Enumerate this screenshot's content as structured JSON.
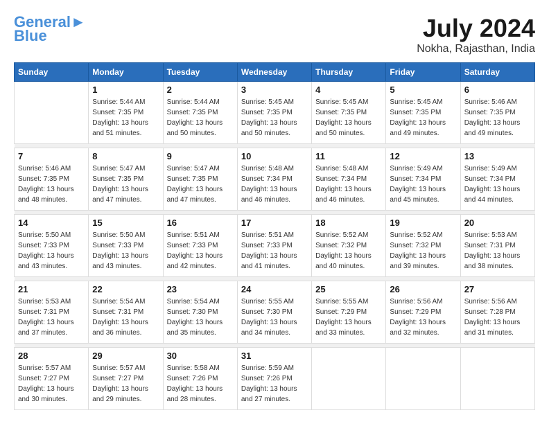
{
  "logo": {
    "line1": "General",
    "line2": "Blue"
  },
  "title": "July 2024",
  "location": "Nokha, Rajasthan, India",
  "headers": [
    "Sunday",
    "Monday",
    "Tuesday",
    "Wednesday",
    "Thursday",
    "Friday",
    "Saturday"
  ],
  "weeks": [
    [
      {
        "day": "",
        "sunrise": "",
        "sunset": "",
        "daylight": ""
      },
      {
        "day": "1",
        "sunrise": "Sunrise: 5:44 AM",
        "sunset": "Sunset: 7:35 PM",
        "daylight": "Daylight: 13 hours and 51 minutes."
      },
      {
        "day": "2",
        "sunrise": "Sunrise: 5:44 AM",
        "sunset": "Sunset: 7:35 PM",
        "daylight": "Daylight: 13 hours and 50 minutes."
      },
      {
        "day": "3",
        "sunrise": "Sunrise: 5:45 AM",
        "sunset": "Sunset: 7:35 PM",
        "daylight": "Daylight: 13 hours and 50 minutes."
      },
      {
        "day": "4",
        "sunrise": "Sunrise: 5:45 AM",
        "sunset": "Sunset: 7:35 PM",
        "daylight": "Daylight: 13 hours and 50 minutes."
      },
      {
        "day": "5",
        "sunrise": "Sunrise: 5:45 AM",
        "sunset": "Sunset: 7:35 PM",
        "daylight": "Daylight: 13 hours and 49 minutes."
      },
      {
        "day": "6",
        "sunrise": "Sunrise: 5:46 AM",
        "sunset": "Sunset: 7:35 PM",
        "daylight": "Daylight: 13 hours and 49 minutes."
      }
    ],
    [
      {
        "day": "7",
        "sunrise": "Sunrise: 5:46 AM",
        "sunset": "Sunset: 7:35 PM",
        "daylight": "Daylight: 13 hours and 48 minutes."
      },
      {
        "day": "8",
        "sunrise": "Sunrise: 5:47 AM",
        "sunset": "Sunset: 7:35 PM",
        "daylight": "Daylight: 13 hours and 47 minutes."
      },
      {
        "day": "9",
        "sunrise": "Sunrise: 5:47 AM",
        "sunset": "Sunset: 7:35 PM",
        "daylight": "Daylight: 13 hours and 47 minutes."
      },
      {
        "day": "10",
        "sunrise": "Sunrise: 5:48 AM",
        "sunset": "Sunset: 7:34 PM",
        "daylight": "Daylight: 13 hours and 46 minutes."
      },
      {
        "day": "11",
        "sunrise": "Sunrise: 5:48 AM",
        "sunset": "Sunset: 7:34 PM",
        "daylight": "Daylight: 13 hours and 46 minutes."
      },
      {
        "day": "12",
        "sunrise": "Sunrise: 5:49 AM",
        "sunset": "Sunset: 7:34 PM",
        "daylight": "Daylight: 13 hours and 45 minutes."
      },
      {
        "day": "13",
        "sunrise": "Sunrise: 5:49 AM",
        "sunset": "Sunset: 7:34 PM",
        "daylight": "Daylight: 13 hours and 44 minutes."
      }
    ],
    [
      {
        "day": "14",
        "sunrise": "Sunrise: 5:50 AM",
        "sunset": "Sunset: 7:33 PM",
        "daylight": "Daylight: 13 hours and 43 minutes."
      },
      {
        "day": "15",
        "sunrise": "Sunrise: 5:50 AM",
        "sunset": "Sunset: 7:33 PM",
        "daylight": "Daylight: 13 hours and 43 minutes."
      },
      {
        "day": "16",
        "sunrise": "Sunrise: 5:51 AM",
        "sunset": "Sunset: 7:33 PM",
        "daylight": "Daylight: 13 hours and 42 minutes."
      },
      {
        "day": "17",
        "sunrise": "Sunrise: 5:51 AM",
        "sunset": "Sunset: 7:33 PM",
        "daylight": "Daylight: 13 hours and 41 minutes."
      },
      {
        "day": "18",
        "sunrise": "Sunrise: 5:52 AM",
        "sunset": "Sunset: 7:32 PM",
        "daylight": "Daylight: 13 hours and 40 minutes."
      },
      {
        "day": "19",
        "sunrise": "Sunrise: 5:52 AM",
        "sunset": "Sunset: 7:32 PM",
        "daylight": "Daylight: 13 hours and 39 minutes."
      },
      {
        "day": "20",
        "sunrise": "Sunrise: 5:53 AM",
        "sunset": "Sunset: 7:31 PM",
        "daylight": "Daylight: 13 hours and 38 minutes."
      }
    ],
    [
      {
        "day": "21",
        "sunrise": "Sunrise: 5:53 AM",
        "sunset": "Sunset: 7:31 PM",
        "daylight": "Daylight: 13 hours and 37 minutes."
      },
      {
        "day": "22",
        "sunrise": "Sunrise: 5:54 AM",
        "sunset": "Sunset: 7:31 PM",
        "daylight": "Daylight: 13 hours and 36 minutes."
      },
      {
        "day": "23",
        "sunrise": "Sunrise: 5:54 AM",
        "sunset": "Sunset: 7:30 PM",
        "daylight": "Daylight: 13 hours and 35 minutes."
      },
      {
        "day": "24",
        "sunrise": "Sunrise: 5:55 AM",
        "sunset": "Sunset: 7:30 PM",
        "daylight": "Daylight: 13 hours and 34 minutes."
      },
      {
        "day": "25",
        "sunrise": "Sunrise: 5:55 AM",
        "sunset": "Sunset: 7:29 PM",
        "daylight": "Daylight: 13 hours and 33 minutes."
      },
      {
        "day": "26",
        "sunrise": "Sunrise: 5:56 AM",
        "sunset": "Sunset: 7:29 PM",
        "daylight": "Daylight: 13 hours and 32 minutes."
      },
      {
        "day": "27",
        "sunrise": "Sunrise: 5:56 AM",
        "sunset": "Sunset: 7:28 PM",
        "daylight": "Daylight: 13 hours and 31 minutes."
      }
    ],
    [
      {
        "day": "28",
        "sunrise": "Sunrise: 5:57 AM",
        "sunset": "Sunset: 7:27 PM",
        "daylight": "Daylight: 13 hours and 30 minutes."
      },
      {
        "day": "29",
        "sunrise": "Sunrise: 5:57 AM",
        "sunset": "Sunset: 7:27 PM",
        "daylight": "Daylight: 13 hours and 29 minutes."
      },
      {
        "day": "30",
        "sunrise": "Sunrise: 5:58 AM",
        "sunset": "Sunset: 7:26 PM",
        "daylight": "Daylight: 13 hours and 28 minutes."
      },
      {
        "day": "31",
        "sunrise": "Sunrise: 5:59 AM",
        "sunset": "Sunset: 7:26 PM",
        "daylight": "Daylight: 13 hours and 27 minutes."
      },
      {
        "day": "",
        "sunrise": "",
        "sunset": "",
        "daylight": ""
      },
      {
        "day": "",
        "sunrise": "",
        "sunset": "",
        "daylight": ""
      },
      {
        "day": "",
        "sunrise": "",
        "sunset": "",
        "daylight": ""
      }
    ]
  ]
}
